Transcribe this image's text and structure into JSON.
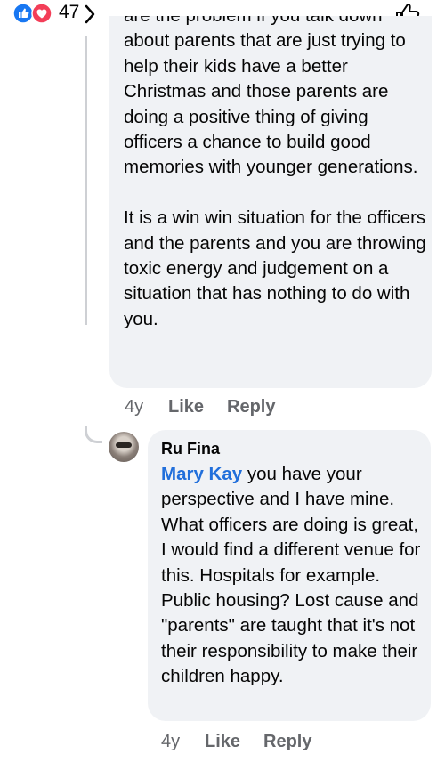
{
  "reactions": {
    "count": "47",
    "icons": [
      "like-icon",
      "love-icon"
    ]
  },
  "comment1": {
    "partial_line": "are the problem if you talk down",
    "paragraph1": "about parents that are just trying to help their kids have a better Christmas and those parents are doing a positive thing of  giving officers a chance to build good memories with younger generations.",
    "paragraph2": "It is a win win situation for the officers and the parents and you are throwing toxic energy and judgement on a situation that has nothing to do with you.",
    "age": "4y",
    "like_label": "Like",
    "reply_label": "Reply"
  },
  "comment2": {
    "author": "Ru Fina",
    "mention": "Mary Kay",
    "text": " you have your perspective and I have mine. What officers are doing is great, I would find a different venue for this. Hospitals for example. Public housing? Lost cause and \"parents\" are taught that it's not their responsibility to make their children happy.",
    "age": "4y",
    "like_label": "Like",
    "reply_label": "Reply"
  },
  "colors": {
    "bubble": "#f0f2f5",
    "mention": "#216fdb",
    "secondary_text": "#65676b",
    "like_blue": "#1877f2",
    "love_red": "#f33e58"
  }
}
